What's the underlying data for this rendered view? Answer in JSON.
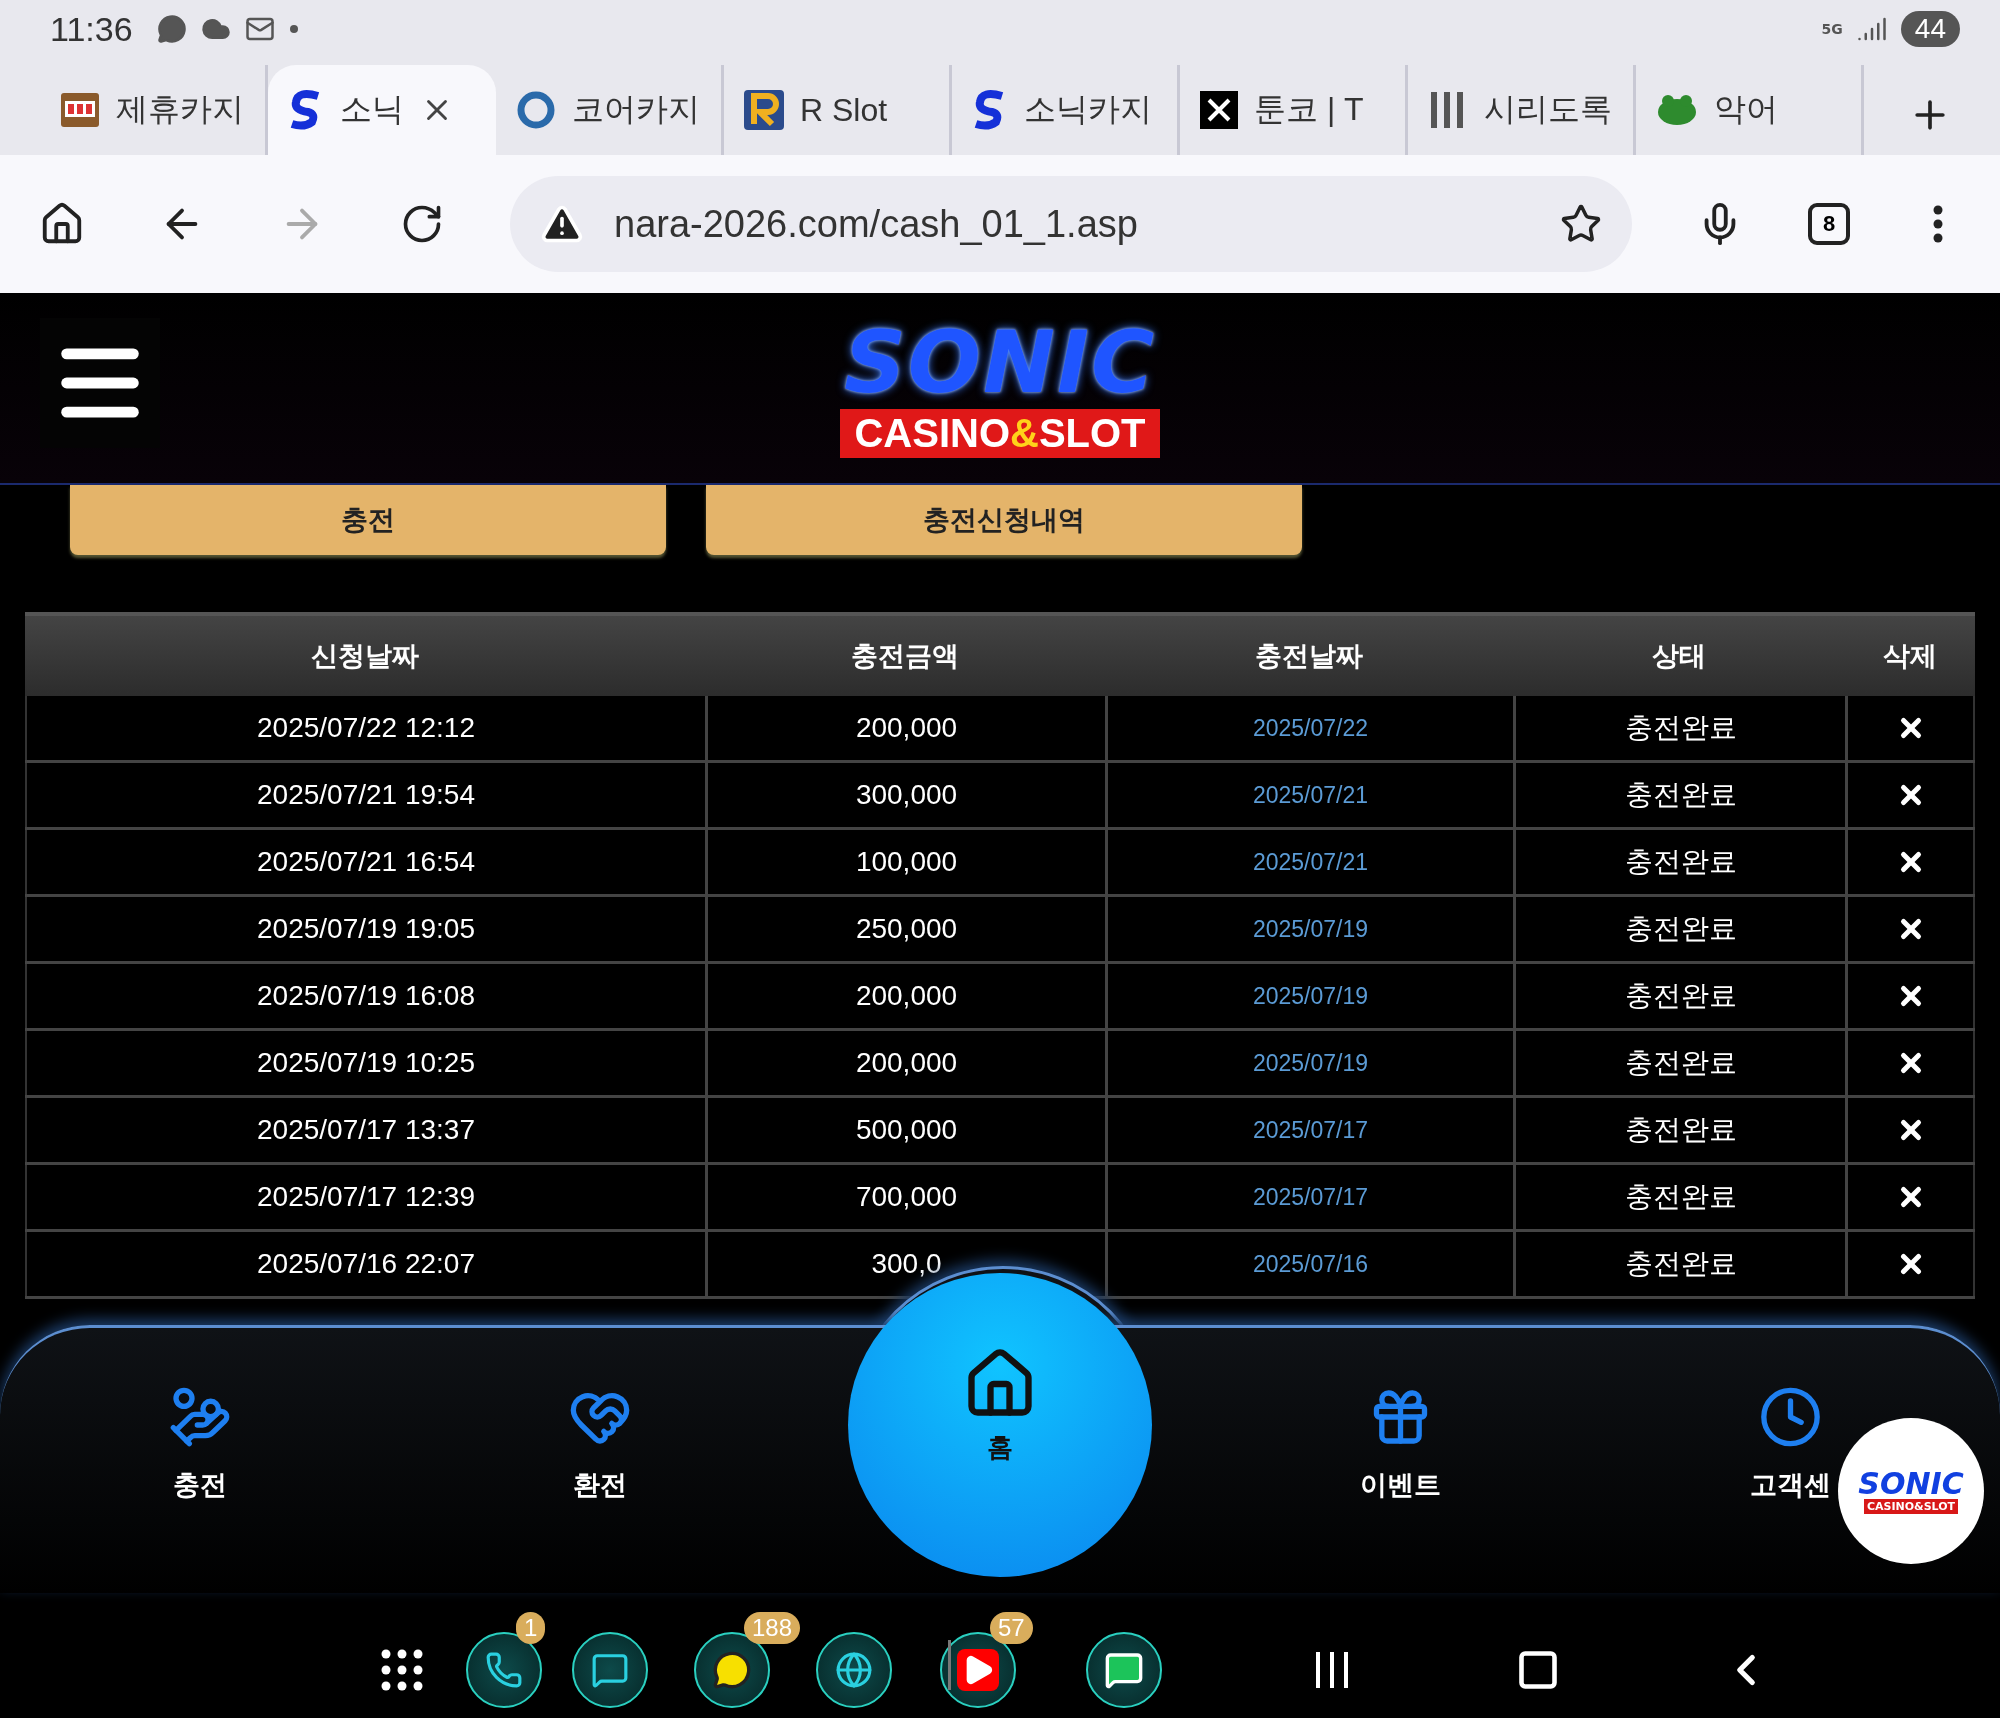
{
  "status_bar": {
    "time": "11:36",
    "network": "5G",
    "battery": "44"
  },
  "tabs": [
    {
      "label": "제휴카지",
      "selected": false
    },
    {
      "label": "소닉",
      "selected": true
    },
    {
      "label": "코어카지",
      "selected": false
    },
    {
      "label": "R Slot",
      "selected": false
    },
    {
      "label": "소닉카지",
      "selected": false
    },
    {
      "label": "툰코 | T",
      "selected": false
    },
    {
      "label": "시리도록",
      "selected": false
    },
    {
      "label": "악어",
      "selected": false
    }
  ],
  "address_bar": {
    "url": "nara-2026.com/cash_01_1.asp",
    "tab_count": "8",
    "forward_disabled": true
  },
  "logo": {
    "title": "SONIC",
    "subtitle": [
      "CASINO",
      "&",
      "SLOT"
    ]
  },
  "buttons": [
    {
      "label": "충전"
    },
    {
      "label": "충전신청내역"
    }
  ],
  "table": {
    "columns": [
      "신청날짜",
      "충전금액",
      "충전날짜",
      "상태",
      "삭제"
    ],
    "rows": [
      [
        "2025/07/22 12:12",
        "200,000",
        "2025/07/22",
        "충전완료"
      ],
      [
        "2025/07/21 19:54",
        "300,000",
        "2025/07/21",
        "충전완료"
      ],
      [
        "2025/07/21 16:54",
        "100,000",
        "2025/07/21",
        "충전완료"
      ],
      [
        "2025/07/19 19:05",
        "250,000",
        "2025/07/19",
        "충전완료"
      ],
      [
        "2025/07/19 16:08",
        "200,000",
        "2025/07/19",
        "충전완료"
      ],
      [
        "2025/07/19 10:25",
        "200,000",
        "2025/07/19",
        "충전완료"
      ],
      [
        "2025/07/17 13:37",
        "500,000",
        "2025/07/17",
        "충전완료"
      ],
      [
        "2025/07/17 12:39",
        "700,000",
        "2025/07/17",
        "충전완료"
      ],
      [
        "2025/07/16 22:07",
        "300,0",
        "2025/07/16",
        "충전완료"
      ]
    ]
  },
  "bottom_nav": [
    {
      "label": "충전"
    },
    {
      "label": "환전"
    },
    {
      "label": "홈"
    },
    {
      "label": "이벤트"
    },
    {
      "label": "고객센"
    }
  ],
  "floating_logo": {
    "title": "SONIC",
    "subtitle": "CASINO&SLOT"
  },
  "dock_badges": [
    "1",
    "188",
    "57"
  ]
}
